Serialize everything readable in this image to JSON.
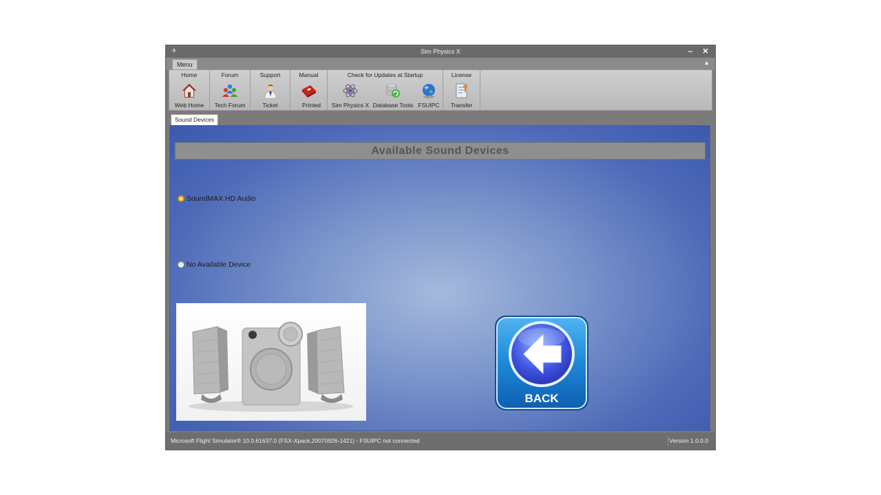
{
  "window": {
    "title": "Sim Physics X",
    "minimize": "‒",
    "close": "✕"
  },
  "menu": {
    "tab_label": "Menu",
    "collapse": "▲"
  },
  "ribbon": {
    "groups": [
      {
        "header": "Home",
        "buttons": [
          {
            "label": "Web Home",
            "icon": "house-icon"
          }
        ]
      },
      {
        "header": "Forum",
        "buttons": [
          {
            "label": "Tech Forum",
            "icon": "people-group-icon"
          }
        ]
      },
      {
        "header": "Support",
        "buttons": [
          {
            "label": "Ticket",
            "icon": "support-person-icon"
          }
        ]
      },
      {
        "header": "Manual",
        "buttons": [
          {
            "label": "Printed",
            "icon": "pdf-document-icon"
          }
        ]
      },
      {
        "header": "Check for Updates at Startup",
        "buttons": [
          {
            "label": "Sim Physics X",
            "icon": "atom-icon"
          },
          {
            "label": "Database Tools",
            "icon": "database-refresh-icon"
          },
          {
            "label": "FSUIPC",
            "icon": "globe-icon"
          }
        ]
      },
      {
        "header": "License",
        "buttons": [
          {
            "label": "Transfer",
            "icon": "license-transfer-icon"
          }
        ]
      }
    ]
  },
  "doc_tab": "Sound Devices",
  "content": {
    "heading": "Available Sound Devices",
    "devices": [
      {
        "label": "SoundMAX HD Audio",
        "selected": true
      },
      {
        "label": "No Available Device",
        "selected": false
      }
    ],
    "back_label": "BACK"
  },
  "status": {
    "left": "Microsoft Flight Simulator® 10.0.61637.0 (FSX-Xpack.20070926-1421)   -  FSUIPC not connected",
    "version": "Version 1.0.0.0"
  },
  "colors": {
    "content_blue": "#4c68b7",
    "back_button_blue": "#1e88d8"
  }
}
